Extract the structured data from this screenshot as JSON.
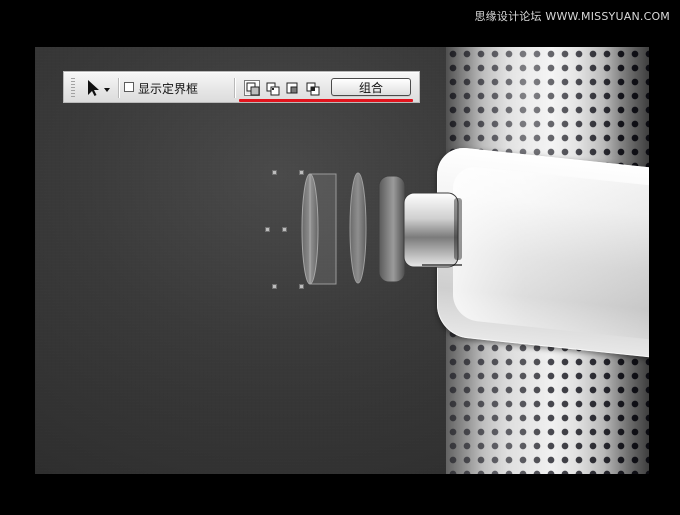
{
  "watermark": {
    "text": "思缘设计论坛 WWW.MISSYUAN.COM"
  },
  "toolbar": {
    "show_bounds_label": "显示定界框",
    "combine_label": "组合"
  },
  "colors": {
    "red_underline": "#e1141d",
    "toolbar_bg": "#e7e7e7",
    "page_bg": "#000000"
  },
  "icons": {
    "tool_arrow": "selection-arrow-icon",
    "dropdown": "chevron-down-icon",
    "checkbox": "checkbox-icon",
    "mode_1": "shape-mode-new-icon",
    "mode_2": "shape-mode-add-icon",
    "mode_3": "shape-mode-subtract-icon",
    "mode_4": "shape-mode-intersect-icon",
    "grip": "toolbar-grip-icon"
  }
}
